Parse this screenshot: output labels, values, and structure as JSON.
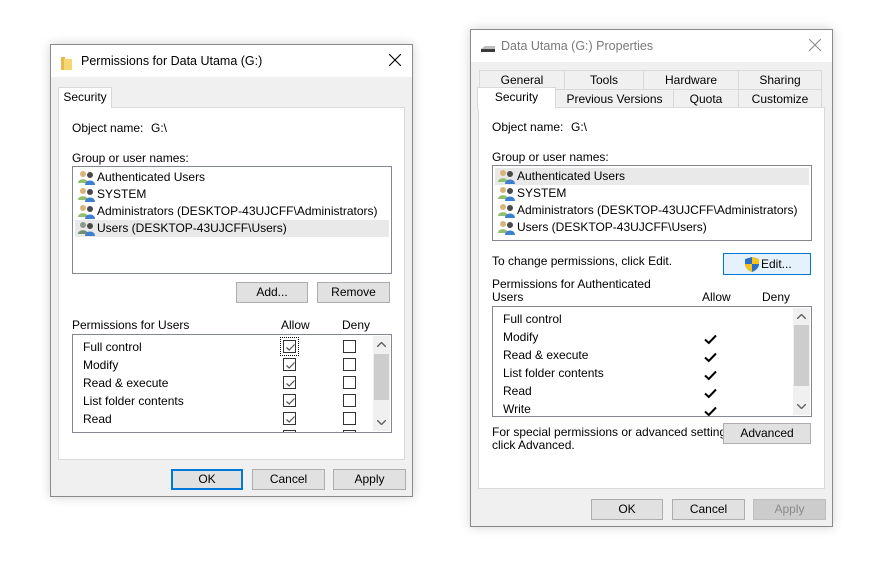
{
  "left_dialog": {
    "title": "Permissions for Data Utama (G:)",
    "tabs": [
      {
        "label": "Security",
        "active": true
      }
    ],
    "object_name_label": "Object name:",
    "object_name_value": "G:\\",
    "group_label": "Group or user names:",
    "users": [
      {
        "name": "Authenticated Users",
        "selected": false
      },
      {
        "name": "SYSTEM",
        "selected": false
      },
      {
        "name": "Administrators (DESKTOP-43UJCFF\\Administrators)",
        "selected": false
      },
      {
        "name": "Users (DESKTOP-43UJCFF\\Users)",
        "selected": true
      }
    ],
    "add_label": "Add...",
    "remove_label": "Remove",
    "permissions_label": "Permissions for Users",
    "allow_label": "Allow",
    "deny_label": "Deny",
    "permissions": [
      {
        "name": "Full control",
        "allow": true,
        "deny": false
      },
      {
        "name": "Modify",
        "allow": true,
        "deny": false
      },
      {
        "name": "Read & execute",
        "allow": true,
        "deny": false
      },
      {
        "name": "List folder contents",
        "allow": true,
        "deny": false
      },
      {
        "name": "Read",
        "allow": true,
        "deny": false
      }
    ],
    "ok_label": "OK",
    "cancel_label": "Cancel",
    "apply_label": "Apply"
  },
  "right_dialog": {
    "title": "Data Utama (G:) Properties",
    "tabs_row1": [
      {
        "label": "General"
      },
      {
        "label": "Tools"
      },
      {
        "label": "Hardware"
      },
      {
        "label": "Sharing"
      }
    ],
    "tabs_row2": [
      {
        "label": "Security",
        "active": true
      },
      {
        "label": "Previous Versions"
      },
      {
        "label": "Quota"
      },
      {
        "label": "Customize"
      }
    ],
    "object_name_label": "Object name:",
    "object_name_value": "G:\\",
    "group_label": "Group or user names:",
    "users": [
      {
        "name": "Authenticated Users",
        "selected": true
      },
      {
        "name": "SYSTEM",
        "selected": false
      },
      {
        "name": "Administrators (DESKTOP-43UJCFF\\Administrators)",
        "selected": false
      },
      {
        "name": "Users (DESKTOP-43UJCFF\\Users)",
        "selected": false
      }
    ],
    "change_hint": "To change permissions, click Edit.",
    "edit_label": "Edit...",
    "permissions_label_line1": "Permissions for Authenticated",
    "permissions_label_line2": "Users",
    "allow_label": "Allow",
    "deny_label": "Deny",
    "permissions": [
      {
        "name": "Full control",
        "allow": false,
        "deny": false
      },
      {
        "name": "Modify",
        "allow": true,
        "deny": false
      },
      {
        "name": "Read & execute",
        "allow": true,
        "deny": false
      },
      {
        "name": "List folder contents",
        "allow": true,
        "deny": false
      },
      {
        "name": "Read",
        "allow": true,
        "deny": false
      },
      {
        "name": "Write",
        "allow": true,
        "deny": false
      }
    ],
    "advanced_hint_line1": "For special permissions or advanced settings,",
    "advanced_hint_line2": "click Advanced.",
    "advanced_label": "Advanced",
    "ok_label": "OK",
    "cancel_label": "Cancel",
    "apply_label": "Apply",
    "apply_enabled": false
  },
  "colors": {
    "accent": "#0078d7",
    "window_bg": "#f0f0f0",
    "selection_bg": "#e9e9e9"
  }
}
